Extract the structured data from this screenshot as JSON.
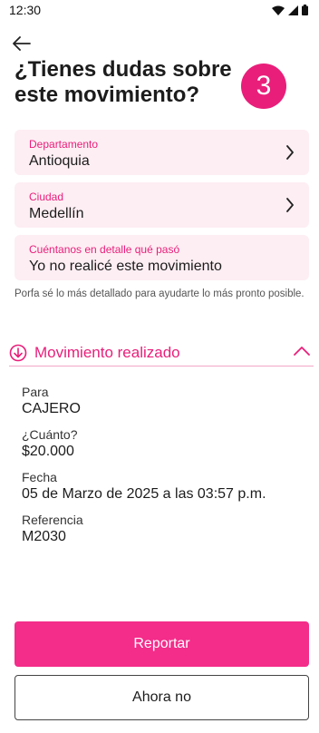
{
  "status_bar": {
    "time": "12:30"
  },
  "header": {
    "title": "¿Tienes dudas sobre este movimiento?",
    "step": "3"
  },
  "form": {
    "departamento": {
      "label": "Departamento",
      "value": "Antioquia"
    },
    "ciudad": {
      "label": "Ciudad",
      "value": "Medellín"
    },
    "detalle": {
      "label": "Cuéntanos en detalle qué pasó",
      "value": "Yo no realicé este movimiento"
    },
    "helper": "Porfa sé lo más detallado para ayudarte lo más pronto posible."
  },
  "movement": {
    "title": "Movimiento realizado",
    "items": [
      {
        "label": "Para",
        "value": "CAJERO"
      },
      {
        "label": "¿Cuánto?",
        "value": "$20.000"
      },
      {
        "label": "Fecha",
        "value": "05 de Marzo de 2025 a las 03:57 p.m."
      },
      {
        "label": "Referencia",
        "value": "M2030"
      }
    ]
  },
  "actions": {
    "primary": "Reportar",
    "secondary": "Ahora no"
  },
  "colors": {
    "accent": "#e91e7a",
    "button": "#f42c8a",
    "field_bg": "#fdeef3"
  }
}
